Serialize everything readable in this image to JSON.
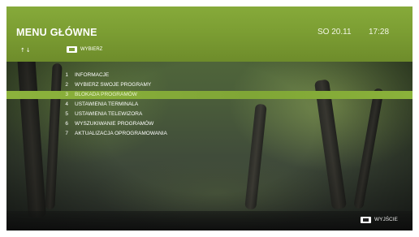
{
  "header": {
    "title": "MENU GŁÓWNE",
    "date": "SO 20.11",
    "time": "17:28",
    "nav_hint_arrows": "↑↓",
    "select_hint": "WYBIERZ"
  },
  "menu": {
    "items": [
      {
        "num": "1",
        "label": "INFORMACJE"
      },
      {
        "num": "2",
        "label": "WYBIERZ SWOJE PROGRAMY"
      },
      {
        "num": "3",
        "label": "BLOKADA PROGRAMÓW"
      },
      {
        "num": "4",
        "label": "USTAWIENIA TERMINALA"
      },
      {
        "num": "5",
        "label": "USTAWIENIA TELEWIZORA"
      },
      {
        "num": "6",
        "label": "WYSZUKIWANIE PROGRAMÓW"
      },
      {
        "num": "7",
        "label": "AKTUALIZACJA OPROGRAMOWANIA"
      }
    ],
    "selected_index": 2
  },
  "footer": {
    "exit_label": "WYJŚCIE"
  },
  "colors": {
    "accent": "#80a636",
    "header": "#7c9e33"
  }
}
